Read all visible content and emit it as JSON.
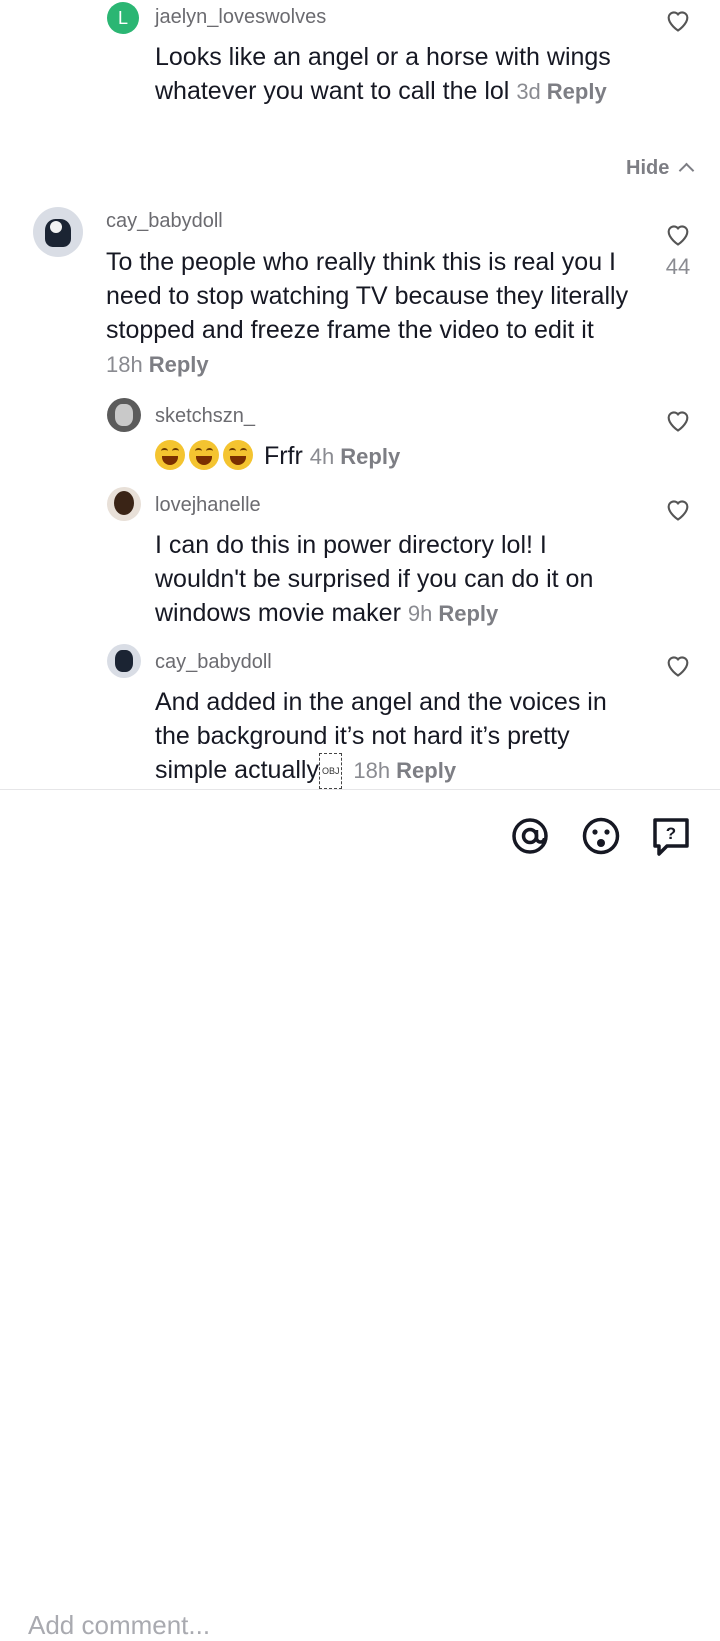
{
  "comments": [
    {
      "user": "jaelyn_loveswolves",
      "text": "Looks like an angel or a horse with wings whatever you want to call the lol",
      "time": "3d",
      "reply": "Reply",
      "avatar_letter": "L"
    },
    {
      "user": "cay_babydoll",
      "text": "To the people who really think this is real you I need to stop watching TV because they literally stopped and freeze frame the video to edit it",
      "time": "18h",
      "reply": "Reply",
      "likes": "44"
    },
    {
      "user": "sketchszn_",
      "text": "Frfr",
      "time": "4h",
      "reply": "Reply"
    },
    {
      "user": "lovejhanelle",
      "text": "I can do this in power directory lol! I wouldn't be surprised if you can do it on windows movie maker",
      "time": "9h",
      "reply": "Reply"
    },
    {
      "user": "cay_babydoll",
      "text": "And added in the angel and the voices in the background it’s not hard it’s pretty simple actually",
      "time": "18h",
      "reply": "Reply",
      "obj": "OBJ"
    }
  ],
  "hide_label": "Hide",
  "composer": {
    "placeholder": "Add comment..."
  },
  "colors": {
    "avatar_green": "#2bb673",
    "text": "#161823",
    "muted": "#8a8b91"
  }
}
